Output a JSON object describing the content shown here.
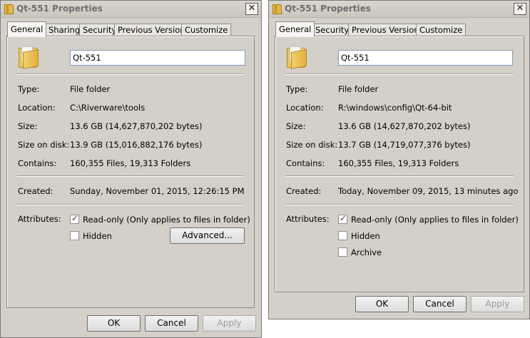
{
  "left": {
    "title": "Qt-551 Properties",
    "tabs": [
      "General",
      "Sharing",
      "Security",
      "Previous Versions",
      "Customize"
    ],
    "name": "Qt-551",
    "labels": {
      "type": "Type:",
      "location": "Location:",
      "size": "Size:",
      "size_on_disk": "Size on disk:",
      "contains": "Contains:",
      "created": "Created:",
      "attributes": "Attributes:"
    },
    "values": {
      "type": "File folder",
      "location": "C:\\Riverware\\tools",
      "size": "13.6 GB (14,627,870,202 bytes)",
      "size_on_disk": "13.9 GB (15,016,882,176 bytes)",
      "contains": "160,355 Files, 19,313 Folders",
      "created": "Sunday, November 01, 2015, 12:26:15 PM"
    },
    "attributes": [
      {
        "label": "Read-only (Only applies to files in folder)",
        "checked": true
      },
      {
        "label": "Hidden",
        "checked": false
      }
    ],
    "advanced_label": "Advanced...",
    "buttons": {
      "ok": "OK",
      "cancel": "Cancel",
      "apply": "Apply"
    }
  },
  "right": {
    "title": "Qt-551 Properties",
    "tabs": [
      "General",
      "Security",
      "Previous Versions",
      "Customize"
    ],
    "name": "Qt-551",
    "labels": {
      "type": "Type:",
      "location": "Location:",
      "size": "Size:",
      "size_on_disk": "Size on disk:",
      "contains": "Contains:",
      "created": "Created:",
      "attributes": "Attributes:"
    },
    "values": {
      "type": "File folder",
      "location": "R:\\windows\\config\\Qt-64-bit",
      "size": "13.6 GB (14,627,870,202 bytes)",
      "size_on_disk": "13.7 GB (14,719,077,376 bytes)",
      "contains": "160,355 Files, 19,313 Folders",
      "created": "Today, November 09, 2015, 13 minutes ago"
    },
    "attributes": [
      {
        "label": "Read-only (Only applies to files in folder)",
        "checked": true
      },
      {
        "label": "Hidden",
        "checked": false
      },
      {
        "label": "Archive",
        "checked": false
      }
    ],
    "buttons": {
      "ok": "OK",
      "cancel": "Cancel",
      "apply": "Apply"
    }
  },
  "icons": {
    "title_icon": "folder-icon",
    "close": "close-icon",
    "large_folder": "folder-icon"
  },
  "colors": {
    "dialog_bg": "#d4d0c8",
    "field_border": "#7f9db9"
  }
}
